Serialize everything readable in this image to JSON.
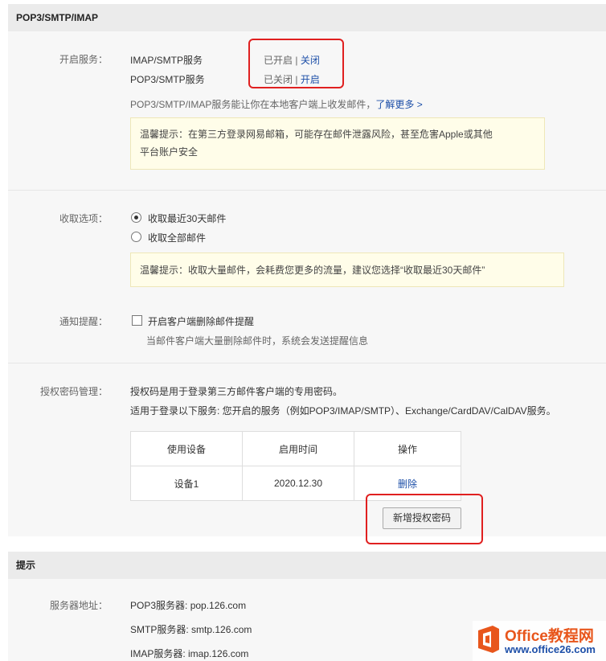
{
  "pop_panel": {
    "title": "POP3/SMTP/IMAP",
    "service_label": "开启服务：",
    "services": [
      {
        "name": "IMAP/SMTP服务",
        "status": "已开启",
        "sep": " | ",
        "action": "关闭"
      },
      {
        "name": "POP3/SMTP服务",
        "status": "已关闭",
        "sep": " | ",
        "action": "开启"
      }
    ],
    "service_desc": "POP3/SMTP/IMAP服务能让你在本地客户端上收发邮件，",
    "learn_more": "了解更多 >",
    "tip1_line1": "温馨提示：在第三方登录网易邮箱，可能存在邮件泄露风险，甚至危害Apple或其他",
    "tip1_line2": "平台账户安全",
    "receive_label": "收取选项：",
    "receive_options": [
      {
        "label": "收取最近30天邮件",
        "checked": true
      },
      {
        "label": "收取全部邮件",
        "checked": false
      }
    ],
    "tip2": "温馨提示：收取大量邮件，会耗费您更多的流量，建议您选择“收取最近30天邮件”",
    "notify_label": "通知提醒：",
    "notify_checkbox": "开启客户端删除邮件提醒",
    "notify_desc": "当邮件客户端大量删除邮件时，系统会发送提醒信息",
    "auth_label": "授权密码管理：",
    "auth_desc1": "授权码是用于登录第三方邮件客户端的专用密码。",
    "auth_desc2": "适用于登录以下服务: 您开启的服务（例如POP3/IMAP/SMTP）、Exchange/CardDAV/CalDAV服务。",
    "table": {
      "headers": [
        "使用设备",
        "启用时间",
        "操作"
      ],
      "rows": [
        {
          "device": "设备1",
          "date": "2020.12.30",
          "action": "删除"
        }
      ]
    },
    "add_button": "新增授权密码"
  },
  "hint_panel": {
    "title": "提示",
    "server_label": "服务器地址：",
    "servers": [
      {
        "label": "POP3服务器: ",
        "value": "pop.126.com"
      },
      {
        "label": "SMTP服务器: ",
        "value": "smtp.126.com"
      },
      {
        "label": "IMAP服务器: ",
        "value": "imap.126.com"
      }
    ]
  },
  "watermark": {
    "brand": "Office教程网",
    "url": "www.office26.com",
    "colors": {
      "brand": "#e8561c",
      "url": "#1d4fa8"
    }
  },
  "colors": {
    "link": "#1d4fa8",
    "highlight_box": "#e02020",
    "tip_bg": "#fffde9"
  }
}
